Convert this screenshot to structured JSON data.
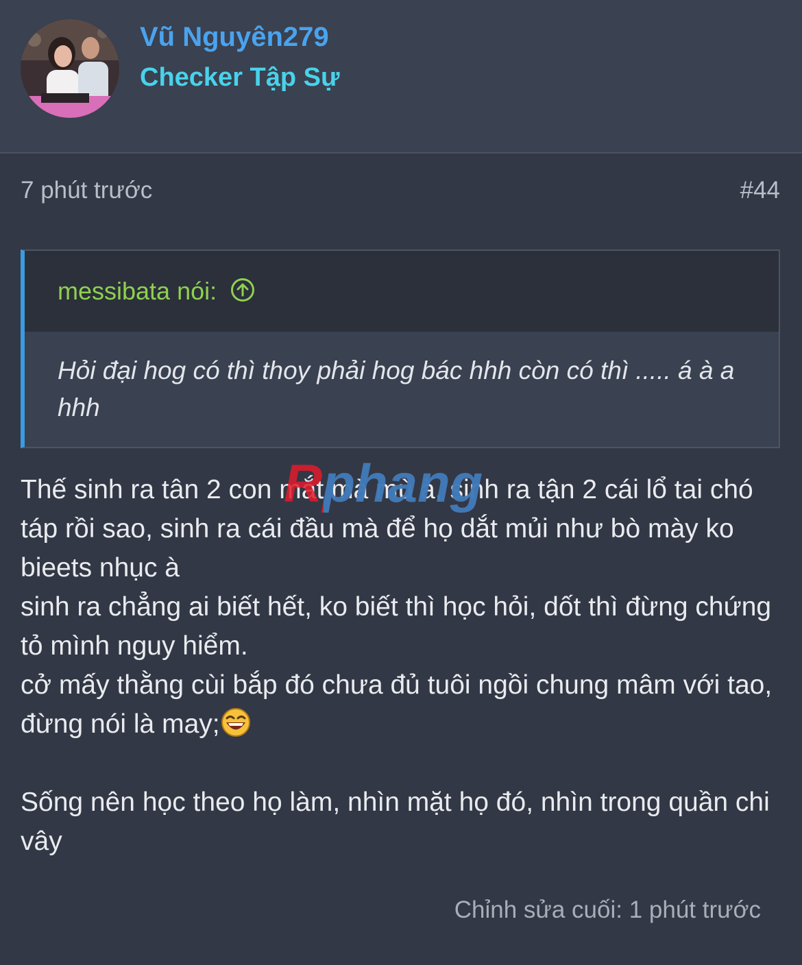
{
  "user": {
    "name": "Vũ Nguyên279",
    "title": "Checker Tập Sự"
  },
  "post": {
    "timestamp": "7 phút trước",
    "number": "#44",
    "quote": {
      "author": "messibata nói:",
      "text": "Hỏi đại hog có thì thoy phải hog bác hhh còn có thì ..... á à a hhh"
    },
    "paragraphs": [
      "Thế sinh ra tân 2 con mắt mà mù à, sinh ra tận 2 cái lổ tai chó táp rồi sao, sinh ra cái đầu mà để họ dắt mủi như bò mày ko bieets nhục à",
      "sinh ra chẳng ai biết hết, ko biết thì học hỏi, dốt thì đừng chứng tỏ mình nguy hiểm.",
      "cở mấy thằng cùi bắp đó chưa đủ tuôi ngồi chung mâm với tao, đừng nói là may;",
      "Sống nên học theo họ làm, nhìn mặt họ đó, nhìn trong quần chi vây"
    ],
    "edited": "Chỉnh sửa cuối: 1 phút trước"
  },
  "watermark": {
    "logo": "Rphang"
  },
  "colors": {
    "background": "#323845",
    "header": "#3a4150",
    "username": "#4aa3ee",
    "usertitle": "#49d2ea",
    "quote_author": "#8fd14f",
    "quote_bar": "#3c9be0"
  },
  "icons": {
    "quote_jump": "arrow-up-circle-icon",
    "emoji": "laughing-face-icon"
  }
}
